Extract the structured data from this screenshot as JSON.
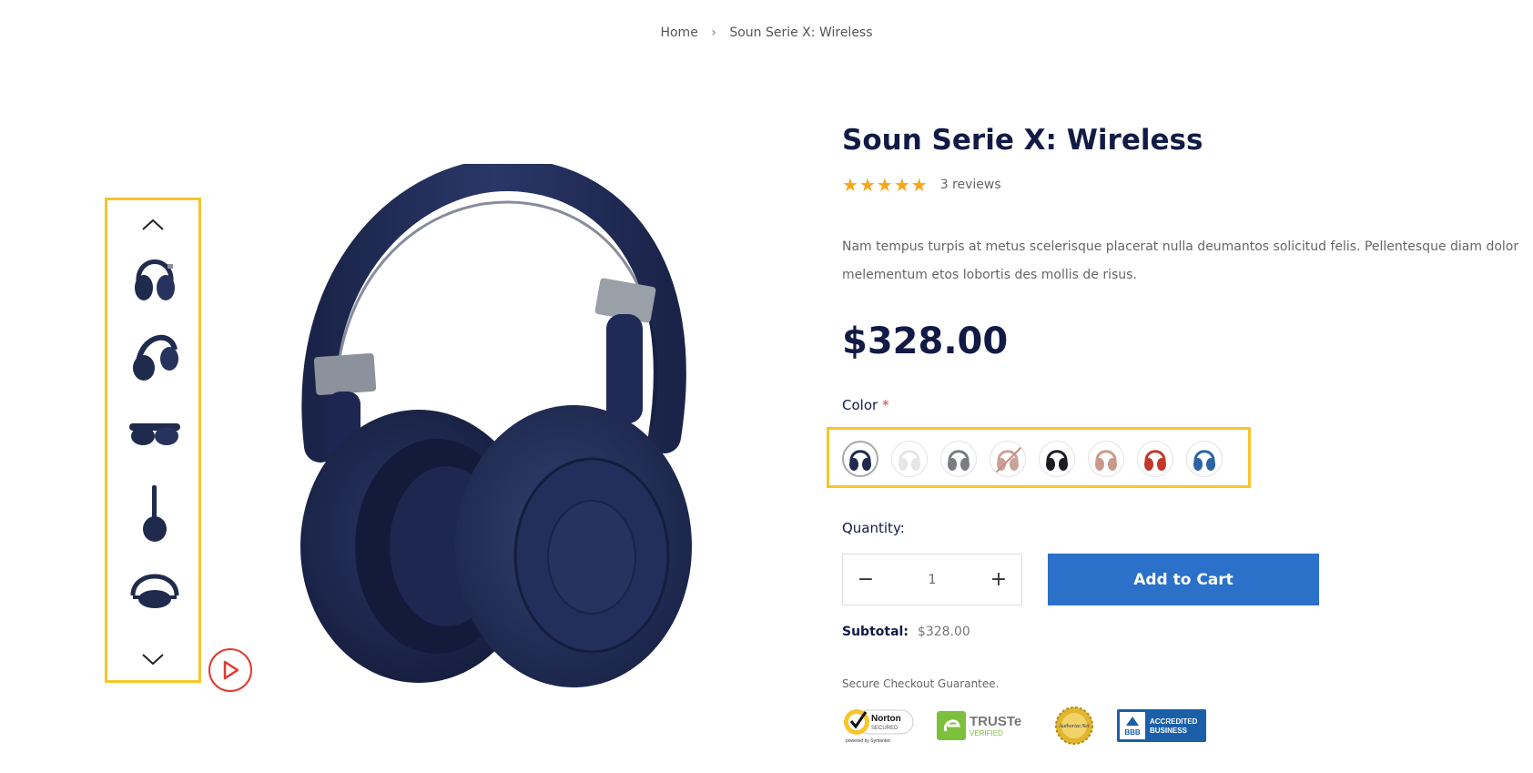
{
  "breadcrumb": {
    "home": "Home",
    "separator": "›",
    "current": "Soun Serie X: Wireless"
  },
  "thumbnails": [
    {
      "name": "front-view",
      "icon": "headphones-front-icon"
    },
    {
      "name": "side-view",
      "icon": "headphones-side-icon"
    },
    {
      "name": "folded-view",
      "icon": "headphones-folded-icon"
    },
    {
      "name": "profile-view",
      "icon": "headphones-profile-icon"
    },
    {
      "name": "top-view",
      "icon": "headphones-top-icon"
    }
  ],
  "product": {
    "title": "Soun Serie X: Wireless",
    "rating": 5,
    "reviews": "3 reviews",
    "description": "Nam tempus turpis at metus scelerisque placerat nulla deumantos solicitud felis. Pellentesque diam dolor melementum etos lobortis des mollis de risus.",
    "price": "$328.00",
    "color_label": "Color",
    "required_mark": "*",
    "colors": [
      {
        "name": "navy",
        "hex": "#1f2a4d",
        "selected": true,
        "unavailable": false
      },
      {
        "name": "white",
        "hex": "#e6e6e6",
        "selected": false,
        "unavailable": false
      },
      {
        "name": "gray",
        "hex": "#7a7d82",
        "selected": false,
        "unavailable": false
      },
      {
        "name": "rose-unavailable",
        "hex": "#c9a39a",
        "selected": false,
        "unavailable": true
      },
      {
        "name": "black",
        "hex": "#1c1c22",
        "selected": false,
        "unavailable": false
      },
      {
        "name": "rose",
        "hex": "#c99a8c",
        "selected": false,
        "unavailable": false
      },
      {
        "name": "red",
        "hex": "#c2392c",
        "selected": false,
        "unavailable": false
      },
      {
        "name": "blue",
        "hex": "#2d62a6",
        "selected": false,
        "unavailable": false
      }
    ],
    "quantity_label": "Quantity:",
    "quantity_value": "1",
    "minus": "−",
    "plus": "+",
    "add_to_cart": "Add to Cart",
    "subtotal_label": "Subtotal:",
    "subtotal_value": "$328.00",
    "secure_text": "Secure Checkout Guarantee."
  },
  "badges": {
    "norton": {
      "line1": "Norton",
      "line2": "SECURED",
      "line3": "powered by Symantec"
    },
    "truste": {
      "line1": "TRUSTe",
      "line2": "VERIFIED"
    },
    "authorize": {
      "line1": "Authorize.Net"
    },
    "bbb": {
      "line1": "ACCREDITED",
      "line2": "BUSINESS",
      "logo": "BBB"
    }
  },
  "colors": {
    "accent": "#2b71c9",
    "title": "#121b46",
    "star": "#f6a818",
    "highlight": "#f7c52b",
    "play": "#e4392f"
  }
}
